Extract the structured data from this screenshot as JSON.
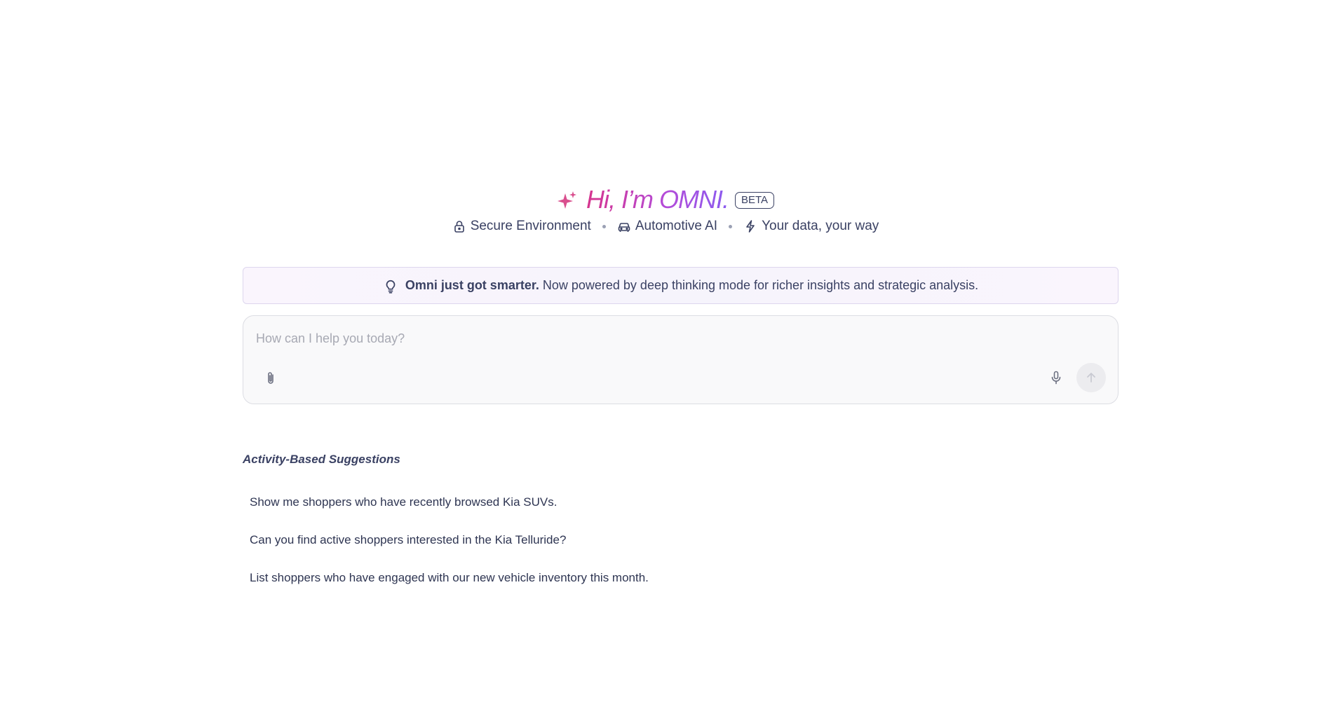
{
  "header": {
    "greeting": "Hi, I’m OMNI.",
    "badge": "BETA",
    "sparkle_icon": "sparkle-icon"
  },
  "features": [
    {
      "label": "Secure Environment",
      "icon": "lock-icon"
    },
    {
      "label": "Automotive AI",
      "icon": "car-icon"
    },
    {
      "label": "Your data, your way",
      "icon": "bolt-icon"
    }
  ],
  "banner": {
    "icon": "lightbulb-icon",
    "bold": "Omni just got smarter.",
    "text": "Now powered by deep thinking mode for richer insights and strategic analysis."
  },
  "composer": {
    "placeholder": "How can I help you today?",
    "value": "",
    "attach_icon": "paperclip-icon",
    "mic_icon": "microphone-icon",
    "send_icon": "arrow-up-icon"
  },
  "suggestions": {
    "title": "Activity-Based Suggestions",
    "items": [
      "Show me shoppers who have recently browsed Kia SUVs.",
      "Can you find active shoppers interested in the Kia Telluride?",
      "List shoppers who have engaged with our new vehicle inventory this month."
    ]
  },
  "colors": {
    "text": "#3a4163",
    "gradient_start": "#d6348d",
    "gradient_end": "#8a5cf0",
    "sparkle": "#d94f8e"
  }
}
